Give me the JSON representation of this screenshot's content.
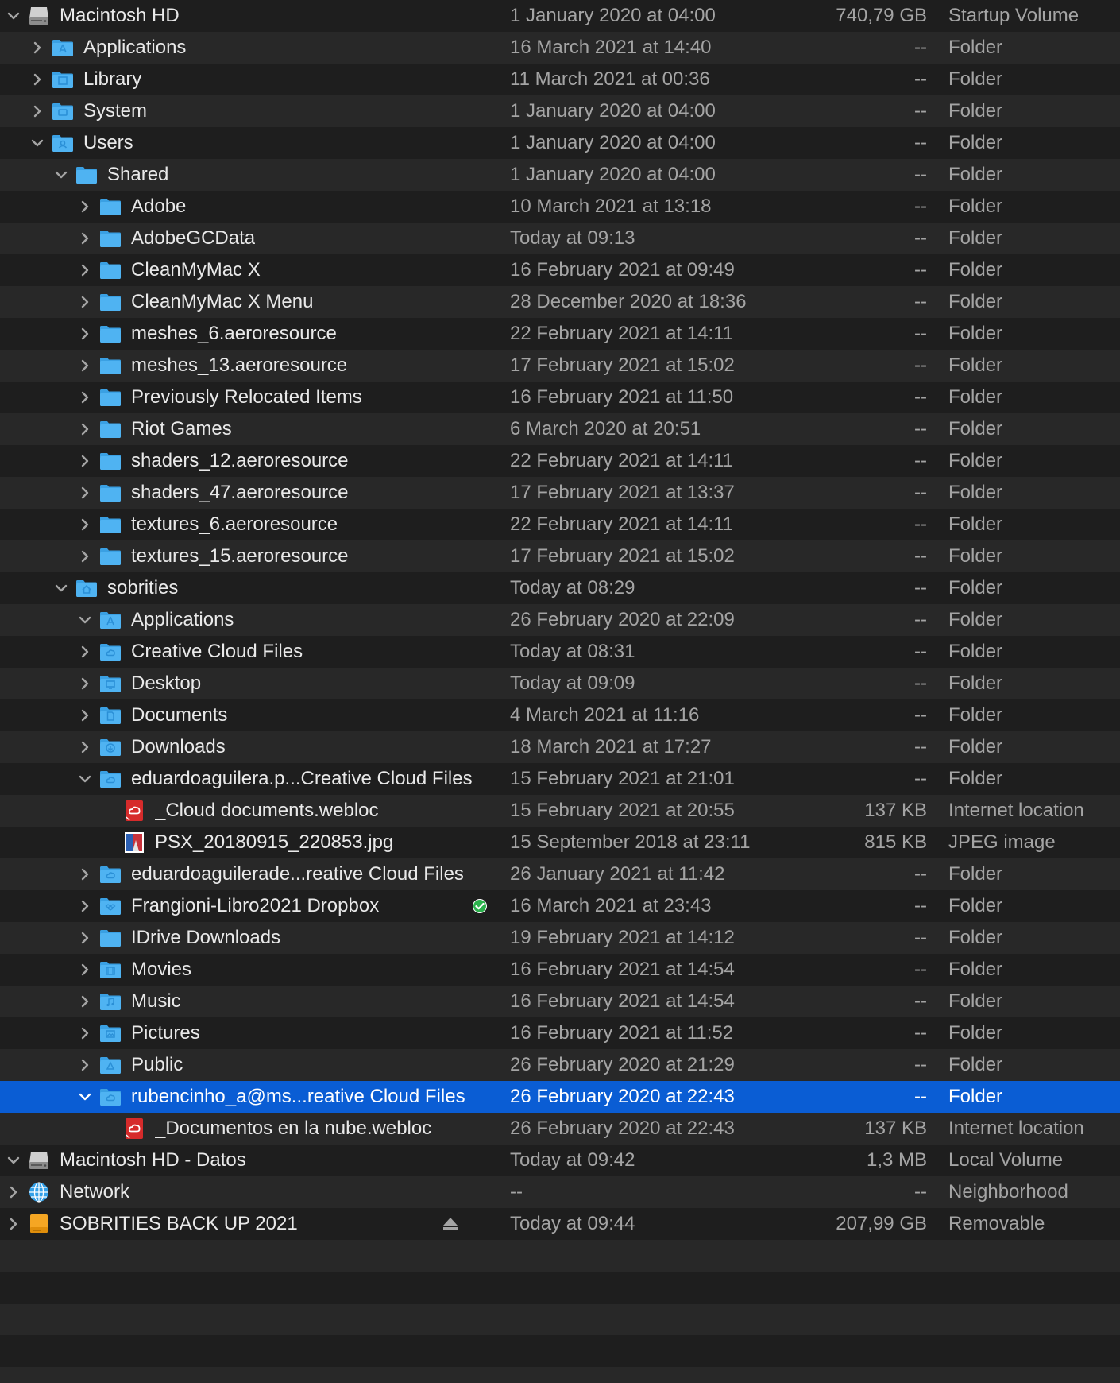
{
  "colors": {
    "background": "#1e1e1e",
    "alt_row": "#282828",
    "selection": "#0a5dd4",
    "folder_blue": "#4fb3f2"
  },
  "rows": [
    {
      "name": "Macintosh HD",
      "date": "1 January 2020 at 04:00",
      "size": "740,79 GB",
      "kind": "Startup Volume",
      "depth": 0,
      "disclosure": "expanded",
      "icon": "hard-drive-icon"
    },
    {
      "name": "Applications",
      "date": "16 March 2021 at 14:40",
      "size": "--",
      "kind": "Folder",
      "depth": 1,
      "disclosure": "collapsed",
      "icon": "applications-folder-icon"
    },
    {
      "name": "Library",
      "date": "11 March 2021 at 00:36",
      "size": "--",
      "kind": "Folder",
      "depth": 1,
      "disclosure": "collapsed",
      "icon": "library-folder-icon"
    },
    {
      "name": "System",
      "date": "1 January 2020 at 04:00",
      "size": "--",
      "kind": "Folder",
      "depth": 1,
      "disclosure": "collapsed",
      "icon": "system-folder-icon"
    },
    {
      "name": "Users",
      "date": "1 January 2020 at 04:00",
      "size": "--",
      "kind": "Folder",
      "depth": 1,
      "disclosure": "expanded",
      "icon": "users-folder-icon"
    },
    {
      "name": "Shared",
      "date": "1 January 2020 at 04:00",
      "size": "--",
      "kind": "Folder",
      "depth": 2,
      "disclosure": "expanded",
      "icon": "folder-icon"
    },
    {
      "name": "Adobe",
      "date": "10 March 2021 at 13:18",
      "size": "--",
      "kind": "Folder",
      "depth": 3,
      "disclosure": "collapsed",
      "icon": "folder-icon"
    },
    {
      "name": "AdobeGCData",
      "date": "Today at 09:13",
      "size": "--",
      "kind": "Folder",
      "depth": 3,
      "disclosure": "collapsed",
      "icon": "folder-icon"
    },
    {
      "name": "CleanMyMac X",
      "date": "16 February 2021 at 09:49",
      "size": "--",
      "kind": "Folder",
      "depth": 3,
      "disclosure": "collapsed",
      "icon": "folder-icon"
    },
    {
      "name": "CleanMyMac X Menu",
      "date": "28 December 2020 at 18:36",
      "size": "--",
      "kind": "Folder",
      "depth": 3,
      "disclosure": "collapsed",
      "icon": "folder-icon"
    },
    {
      "name": "meshes_6.aeroresource",
      "date": "22 February 2021 at 14:11",
      "size": "--",
      "kind": "Folder",
      "depth": 3,
      "disclosure": "collapsed",
      "icon": "folder-icon"
    },
    {
      "name": "meshes_13.aeroresource",
      "date": "17 February 2021 at 15:02",
      "size": "--",
      "kind": "Folder",
      "depth": 3,
      "disclosure": "collapsed",
      "icon": "folder-icon"
    },
    {
      "name": "Previously Relocated Items",
      "date": "16 February 2021 at 11:50",
      "size": "--",
      "kind": "Folder",
      "depth": 3,
      "disclosure": "collapsed",
      "icon": "folder-icon"
    },
    {
      "name": "Riot Games",
      "date": "6 March 2020 at 20:51",
      "size": "--",
      "kind": "Folder",
      "depth": 3,
      "disclosure": "collapsed",
      "icon": "folder-icon"
    },
    {
      "name": "shaders_12.aeroresource",
      "date": "22 February 2021 at 14:11",
      "size": "--",
      "kind": "Folder",
      "depth": 3,
      "disclosure": "collapsed",
      "icon": "folder-icon"
    },
    {
      "name": "shaders_47.aeroresource",
      "date": "17 February 2021 at 13:37",
      "size": "--",
      "kind": "Folder",
      "depth": 3,
      "disclosure": "collapsed",
      "icon": "folder-icon"
    },
    {
      "name": "textures_6.aeroresource",
      "date": "22 February 2021 at 14:11",
      "size": "--",
      "kind": "Folder",
      "depth": 3,
      "disclosure": "collapsed",
      "icon": "folder-icon"
    },
    {
      "name": "textures_15.aeroresource",
      "date": "17 February 2021 at 15:02",
      "size": "--",
      "kind": "Folder",
      "depth": 3,
      "disclosure": "collapsed",
      "icon": "folder-icon"
    },
    {
      "name": "sobrities",
      "date": "Today at 08:29",
      "size": "--",
      "kind": "Folder",
      "depth": 2,
      "disclosure": "expanded",
      "icon": "home-folder-icon"
    },
    {
      "name": "Applications",
      "date": "26 February 2020 at 22:09",
      "size": "--",
      "kind": "Folder",
      "depth": 3,
      "disclosure": "expanded",
      "icon": "applications-folder-icon"
    },
    {
      "name": "Creative Cloud Files",
      "date": "Today at 08:31",
      "size": "--",
      "kind": "Folder",
      "depth": 3,
      "disclosure": "collapsed",
      "icon": "creative-cloud-folder-icon"
    },
    {
      "name": "Desktop",
      "date": "Today at 09:09",
      "size": "--",
      "kind": "Folder",
      "depth": 3,
      "disclosure": "collapsed",
      "icon": "desktop-folder-icon"
    },
    {
      "name": "Documents",
      "date": "4 March 2021 at 11:16",
      "size": "--",
      "kind": "Folder",
      "depth": 3,
      "disclosure": "collapsed",
      "icon": "documents-folder-icon"
    },
    {
      "name": "Downloads",
      "date": "18 March 2021 at 17:27",
      "size": "--",
      "kind": "Folder",
      "depth": 3,
      "disclosure": "collapsed",
      "icon": "downloads-folder-icon"
    },
    {
      "name": "eduardoaguilera.p...Creative Cloud Files",
      "date": "15 February 2021 at 21:01",
      "size": "--",
      "kind": "Folder",
      "depth": 3,
      "disclosure": "expanded",
      "icon": "creative-cloud-folder-icon"
    },
    {
      "name": "_Cloud documents.webloc",
      "date": "15 February 2021 at 20:55",
      "size": "137 KB",
      "kind": "Internet location",
      "depth": 4,
      "disclosure": "none",
      "icon": "webloc-file-icon"
    },
    {
      "name": "PSX_20180915_220853.jpg",
      "date": "15 September 2018 at 23:11",
      "size": "815 KB",
      "kind": "JPEG image",
      "depth": 4,
      "disclosure": "none",
      "icon": "jpeg-image-icon"
    },
    {
      "name": "eduardoaguilerade...reative Cloud Files",
      "date": "26 January 2021 at 11:42",
      "size": "--",
      "kind": "Folder",
      "depth": 3,
      "disclosure": "collapsed",
      "icon": "creative-cloud-folder-icon"
    },
    {
      "name": "Frangioni-Libro2021 Dropbox",
      "date": "16 March 2021 at 23:43",
      "size": "--",
      "kind": "Folder",
      "depth": 3,
      "disclosure": "collapsed",
      "icon": "dropbox-folder-icon",
      "badge": "sync-check-icon"
    },
    {
      "name": "IDrive Downloads",
      "date": "19 February 2021 at 14:12",
      "size": "--",
      "kind": "Folder",
      "depth": 3,
      "disclosure": "collapsed",
      "icon": "folder-icon"
    },
    {
      "name": "Movies",
      "date": "16 February 2021 at 14:54",
      "size": "--",
      "kind": "Folder",
      "depth": 3,
      "disclosure": "collapsed",
      "icon": "movies-folder-icon"
    },
    {
      "name": "Music",
      "date": "16 February 2021 at 14:54",
      "size": "--",
      "kind": "Folder",
      "depth": 3,
      "disclosure": "collapsed",
      "icon": "music-folder-icon"
    },
    {
      "name": "Pictures",
      "date": "16 February 2021 at 11:52",
      "size": "--",
      "kind": "Folder",
      "depth": 3,
      "disclosure": "collapsed",
      "icon": "pictures-folder-icon"
    },
    {
      "name": "Public",
      "date": "26 February 2020 at 21:29",
      "size": "--",
      "kind": "Folder",
      "depth": 3,
      "disclosure": "collapsed",
      "icon": "public-folder-icon"
    },
    {
      "name": "rubencinho_a@ms...reative Cloud Files",
      "date": "26 February 2020 at 22:43",
      "size": "--",
      "kind": "Folder",
      "depth": 3,
      "disclosure": "expanded",
      "icon": "creative-cloud-folder-icon",
      "selected": true
    },
    {
      "name": "_Documentos en la nube.webloc",
      "date": "26 February 2020 at 22:43",
      "size": "137 KB",
      "kind": "Internet location",
      "depth": 4,
      "disclosure": "none",
      "icon": "webloc-file-icon"
    },
    {
      "name": "Macintosh HD - Datos",
      "date": "Today at 09:42",
      "size": "1,3 MB",
      "kind": "Local Volume",
      "depth": 0,
      "disclosure": "expanded",
      "icon": "hard-drive-icon"
    },
    {
      "name": "Network",
      "date": "--",
      "size": "--",
      "kind": "Neighborhood",
      "depth": 0,
      "disclosure": "collapsed",
      "icon": "network-globe-icon"
    },
    {
      "name": "SOBRITIES BACK UP 2021",
      "date": "Today at 09:44",
      "size": "207,99 GB",
      "kind": "Removable",
      "depth": 0,
      "disclosure": "collapsed",
      "icon": "external-drive-icon",
      "eject": "eject-icon"
    }
  ]
}
